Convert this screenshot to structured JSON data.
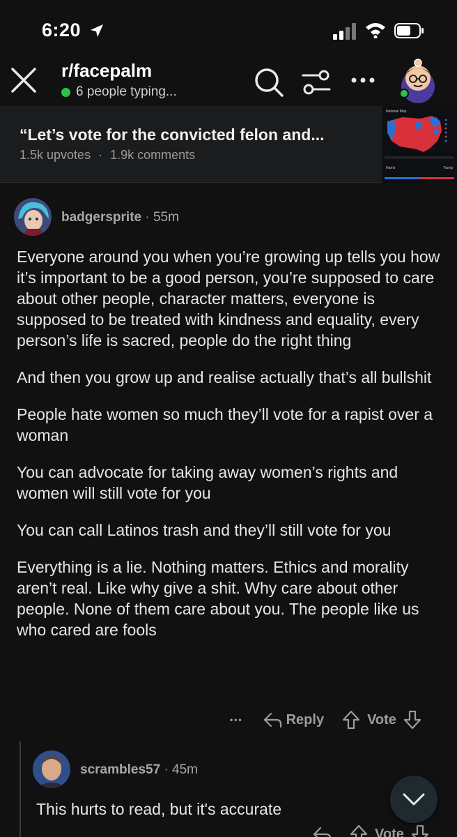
{
  "status_bar": {
    "time": "6:20"
  },
  "header": {
    "subreddit": "r/facepalm",
    "typing_status": "6 people typing..."
  },
  "post": {
    "title": "“Let’s vote for the convicted felon and...",
    "upvotes": "1.5k upvotes",
    "separator": "·",
    "comments": "1.9k comments",
    "thumbnail": {
      "title": "National Map",
      "left_label": "Harris",
      "right_label": "Trump"
    }
  },
  "comments": [
    {
      "author": "badgersprite",
      "time": "55m",
      "paragraphs": [
        "Everyone around you when you’re growing up tells you how it’s important to be a good person, you’re supposed to care about other people, character matters, everyone is supposed to be treated with kindness and equality, every person’s life is sacred, people do the right thing",
        "And then you grow up and realise actually that’s all bullshit",
        "People hate women so much they’ll vote for a rapist over a woman",
        "You can advocate for taking away women’s rights and women will still vote for you",
        "You can call Latinos trash and they’ll still vote for you",
        "Everything is a lie. Nothing matters. Ethics and morality aren’t real. Like why give a shit. Why care about other people. None of them care about you. The people like us who cared are fools"
      ],
      "actions": {
        "more": "•••",
        "reply": "Reply",
        "vote": "Vote"
      }
    },
    {
      "author": "scrambles57",
      "time": "45m",
      "paragraphs": [
        "This hurts to read, but it's accurate"
      ],
      "actions": {
        "vote": "Vote"
      }
    }
  ],
  "colors": {
    "background": "#111112",
    "online_green": "#2fc24a",
    "map_red": "#d8313c",
    "map_blue": "#2d6fd1"
  },
  "icons": [
    "location-arrow-icon",
    "signal-icon",
    "wifi-icon",
    "battery-icon",
    "close-icon",
    "search-icon",
    "filter-icon",
    "more-icon",
    "reply-icon",
    "upvote-icon",
    "downvote-icon",
    "chevron-down-icon"
  ]
}
